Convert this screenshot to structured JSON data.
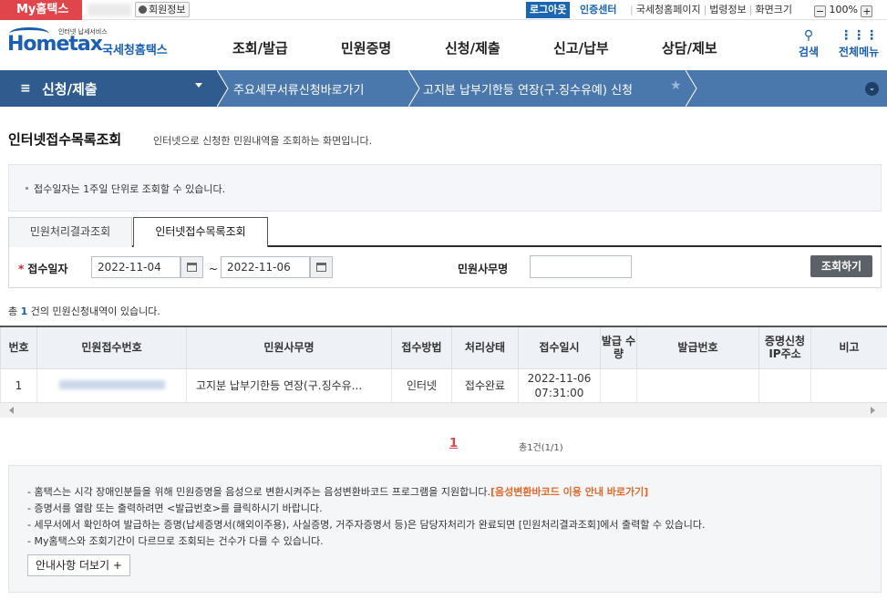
{
  "topbar": {
    "my_hometax": "My홈택스",
    "member_info": "회원정보",
    "logout": "로그아웃",
    "cert_center": "인증센터",
    "links": [
      "국세청홈페이지",
      "법령정보",
      "화면크기"
    ],
    "zoom": "100%",
    "zoom_minus": "−",
    "zoom_plus": "+"
  },
  "logo": {
    "tagline": "인터넷 납세서비스",
    "wordmark": "Hometax",
    "korean": "국세청홈택스",
    "brand_color": "#1a5fb4"
  },
  "nav": {
    "items": [
      "조회/발급",
      "민원증명",
      "신청/제출",
      "신고/납부",
      "상담/제보"
    ],
    "search": "검색",
    "all_menu": "전체메뉴"
  },
  "breadcrumb": {
    "section": "신청/제출",
    "level2": "주요세무서류신청바로가기",
    "level3": "고지분 납부기한등 연장(구.징수유예) 신청"
  },
  "page": {
    "title": "인터넷접수목록조회",
    "description": "인터넷으로 신청한 민원내역을 조회하는 화면입니다.",
    "notice": "접수일자는 1주일 단위로 조회할 수 있습니다."
  },
  "tabs": [
    "민원처리결과조회",
    "인터넷접수목록조회"
  ],
  "search": {
    "date_label": "접수일자",
    "required_mark": "*",
    "from_date": "2022-11-04",
    "tilde": "~",
    "to_date": "2022-11-06",
    "office_label": "민원사무명",
    "office_value": "",
    "button": "조회하기"
  },
  "summary": {
    "prefix": "총",
    "count": "1",
    "suffix": "건의 민원신청내역이 있습니다."
  },
  "table": {
    "headers": [
      "번호",
      "민원접수번호",
      "민원사무명",
      "접수방법",
      "처리상태",
      "접수일시",
      "발급 수량",
      "발급번호",
      "증명신청 IP주소",
      "비고"
    ],
    "rows": [
      {
        "no": "1",
        "receipt_no": "",
        "office": "고지분 납부기한등 연장(구.징수유...",
        "method": "인터넷",
        "status": "접수완료",
        "date": "2022-11-06",
        "time": "07:31:00",
        "qty": "",
        "issue_no": "",
        "ip": "",
        "note": ""
      }
    ]
  },
  "pagination": {
    "current": "1",
    "total": "총1건(1/1)"
  },
  "guide": {
    "items": [
      "홈택스는 시각 장애인분들을 위해 민원증명을 음성으로 변환시켜주는 음성변환바코드 프로그램을 지원합니다.",
      "증명서를 열람 또는 출력하려면 <발급번호>를 클릭하시기 바랍니다.",
      "세무서에서 확인하여 발급하는 증명(납세증명서(해외이주용), 사실증명, 거주자증명서 등)은 담당자처리가 완료되면 [민원처리결과조회]에서 출력할 수 있습니다.",
      "My홈택스와 조회기간이 다르므로 조회되는 건수가 다를 수 있습니다."
    ],
    "link": "[음성변환바코드 이용 안내 바로가기]",
    "more_button": "안내사항 더보기 +"
  }
}
